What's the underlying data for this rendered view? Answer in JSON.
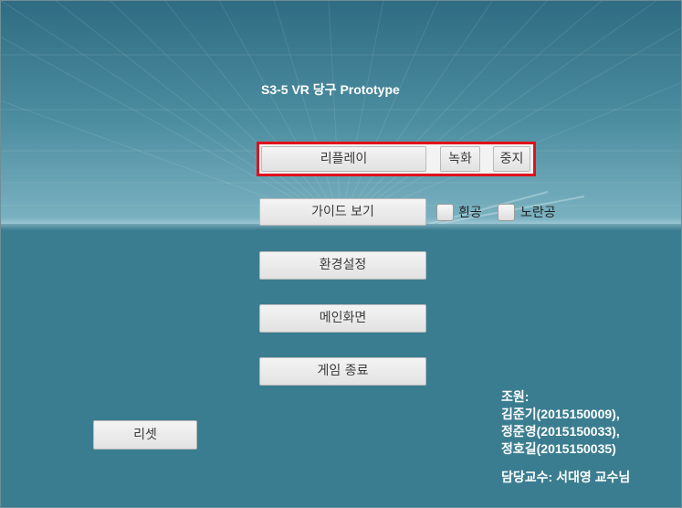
{
  "app": {
    "title": "S3-5 VR 당구 Prototype"
  },
  "replay_row": {
    "replay_label": "리플레이",
    "record_label": "녹화",
    "stop_label": "중지"
  },
  "guide_row": {
    "guide_label": "가이드 보기",
    "white_ball_label": "흰공",
    "yellow_ball_label": "노란공",
    "white_ball_checked": false,
    "yellow_ball_checked": false
  },
  "menu": {
    "settings_label": "환경설정",
    "main_screen_label": "메인화면",
    "exit_label": "게임 종료"
  },
  "reset_label": "리셋",
  "team": {
    "heading": "조원:",
    "members": [
      "김준기(2015150009),",
      "정준영(2015150033),",
      "정호길(2015150035)"
    ],
    "professor": "담당교수: 서대영 교수님"
  },
  "colors": {
    "highlight_border": "#e0121b",
    "background": "#3b7d90"
  }
}
